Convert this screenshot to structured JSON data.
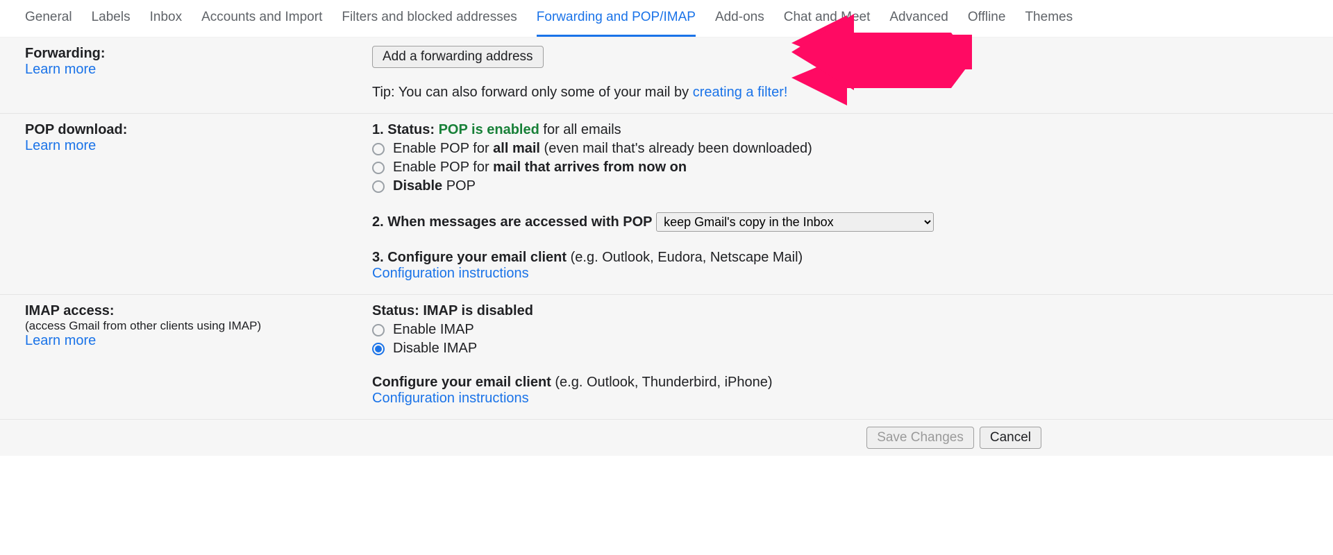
{
  "tabs": {
    "general": "General",
    "labels": "Labels",
    "inbox": "Inbox",
    "accounts": "Accounts and Import",
    "filters": "Filters and blocked addresses",
    "forwarding": "Forwarding and POP/IMAP",
    "addons": "Add-ons",
    "chat": "Chat and Meet",
    "advanced": "Advanced",
    "offline": "Offline",
    "themes": "Themes"
  },
  "forwarding": {
    "heading": "Forwarding:",
    "learn_more": "Learn more",
    "button": "Add a forwarding address",
    "tip_prefix": "Tip: You can also forward only some of your mail by ",
    "tip_link": "creating a filter!"
  },
  "pop": {
    "heading": "POP download:",
    "learn_more": "Learn more",
    "status_prefix": "1. Status: ",
    "status_enabled": "POP is enabled",
    "status_suffix": " for all emails",
    "opt1_prefix": "Enable POP for ",
    "opt1_bold": "all mail",
    "opt1_suffix": " (even mail that's already been downloaded)",
    "opt2_prefix": "Enable POP for ",
    "opt2_bold": "mail that arrives from now on",
    "opt3_bold": "Disable",
    "opt3_suffix": " POP",
    "step2_label": "2. When messages are accessed with POP",
    "step2_option": "keep Gmail's copy in the Inbox",
    "step3_bold": "3. Configure your email client",
    "step3_suffix": " (e.g. Outlook, Eudora, Netscape Mail)",
    "config_link": "Configuration instructions"
  },
  "imap": {
    "heading": "IMAP access:",
    "subtext": "(access Gmail from other clients using IMAP)",
    "learn_more": "Learn more",
    "status": "Status: IMAP is disabled",
    "opt_enable": "Enable IMAP",
    "opt_disable": "Disable IMAP",
    "config_bold": "Configure your email client",
    "config_suffix": " (e.g. Outlook, Thunderbird, iPhone)",
    "config_link": "Configuration instructions"
  },
  "footer": {
    "save": "Save Changes",
    "cancel": "Cancel"
  },
  "annotation": {
    "arrow_color": "#ff0a63"
  }
}
